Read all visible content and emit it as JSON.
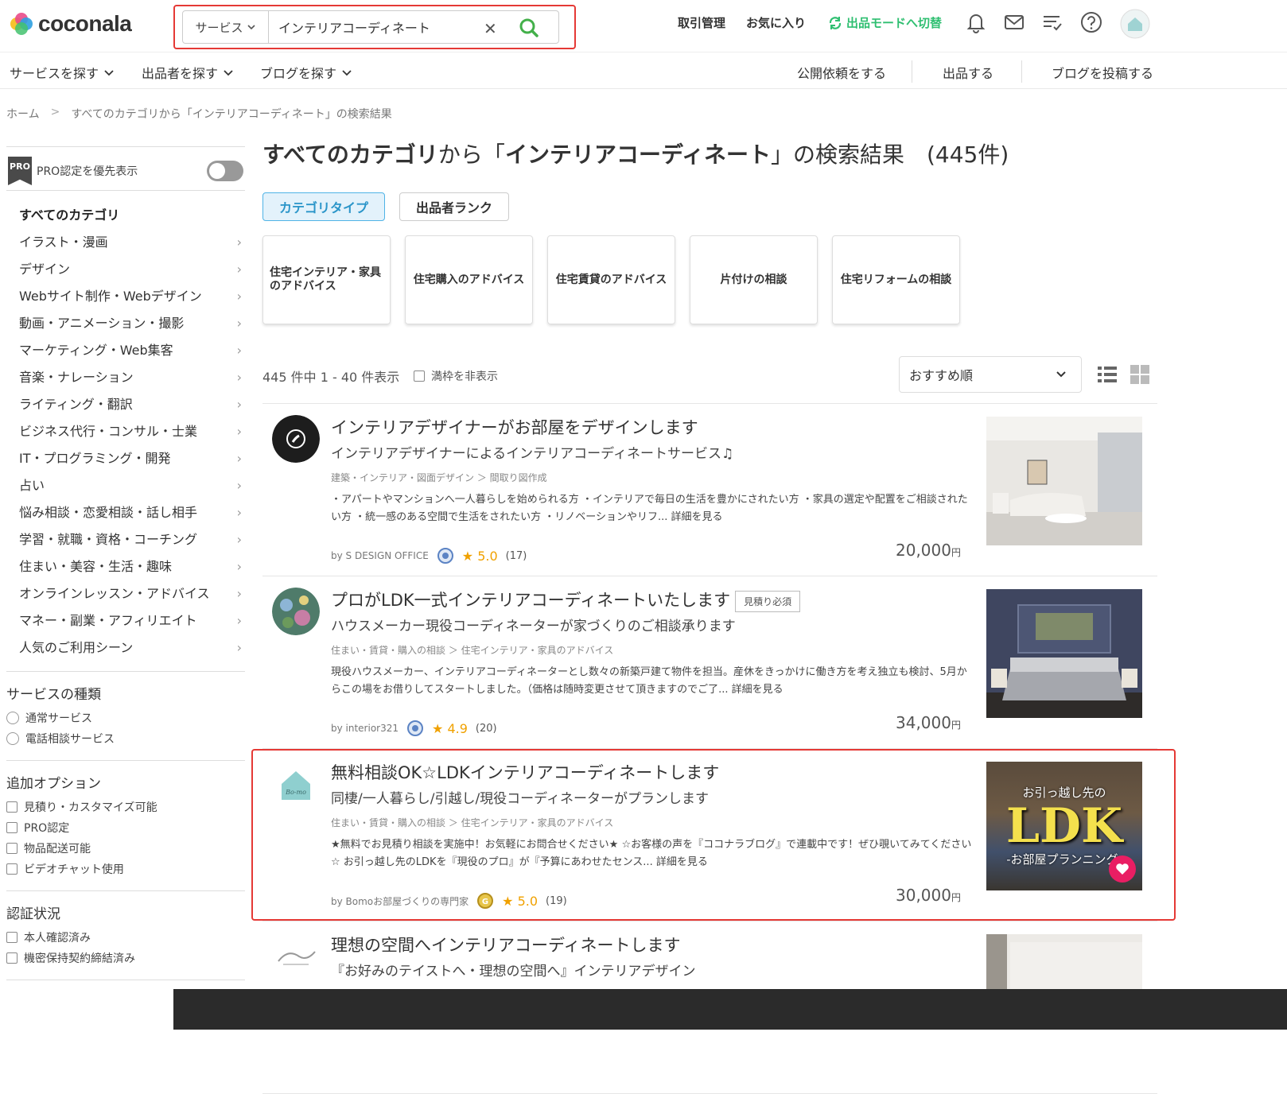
{
  "brand": {
    "name": "coconala"
  },
  "search": {
    "category": "サービス",
    "query": "インテリアコーディネート"
  },
  "header_nav": {
    "deals": "取引管理",
    "favorites": "お気に入り",
    "seller_mode": "出品モードへ切替"
  },
  "subnav": {
    "find_services": "サービスを探す",
    "find_sellers": "出品者を探す",
    "find_blogs": "ブログを探す",
    "public_request": "公開依頼をする",
    "list_service": "出品する",
    "post_blog": "ブログを投稿する"
  },
  "breadcrumb": {
    "home": "ホーム",
    "sep": ">",
    "current": "すべてのカテゴリから「インテリアコーディネート」の検索結果"
  },
  "sidebar": {
    "pro_label": "PRO認定を優先表示",
    "pro_badge": "PRO",
    "categories_heading": "すべてのカテゴリ",
    "categories": [
      "イラスト・漫画",
      "デザイン",
      "Webサイト制作・Webデザイン",
      "動画・アニメーション・撮影",
      "マーケティング・Web集客",
      "音楽・ナレーション",
      "ライティング・翻訳",
      "ビジネス代行・コンサル・士業",
      "IT・プログラミング・開発",
      "占い",
      "悩み相談・恋愛相談・話し相手",
      "学習・就職・資格・コーチング",
      "住まい・美容・生活・趣味",
      "オンラインレッスン・アドバイス",
      "マネー・副業・アフィリエイト",
      "人気のご利用シーン"
    ],
    "service_type": {
      "title": "サービスの種類",
      "options": [
        "通常サービス",
        "電話相談サービス"
      ]
    },
    "options": {
      "title": "追加オプション",
      "options": [
        "見積り・カスタマイズ可能",
        "PRO認定",
        "物品配送可能",
        "ビデオチャット使用"
      ]
    },
    "verification": {
      "title": "認証状況",
      "options": [
        "本人確認済み",
        "機密保持契約締結済み"
      ]
    }
  },
  "main": {
    "title_cat": "すべてのカテゴリ",
    "title_from": "から「",
    "title_query": "インテリアコーディネート",
    "title_suffix": "」の検索結果　(445件)",
    "tabs": [
      "カテゴリタイプ",
      "出品者ランク"
    ],
    "tiles": [
      "住宅インテリア・家具のアドバイス",
      "住宅購入のアドバイス",
      "住宅賃貸のアドバイス",
      "片付けの相談",
      "住宅リフォームの相談"
    ],
    "result_count": "445 件中 1 - 40 件表示",
    "hide_full": "満枠を非表示",
    "sort": "おすすめ順"
  },
  "results": [
    {
      "title": "インテリアデザイナーがお部屋をデザインします",
      "subtitle": "インテリアデザイナーによるインテリアコーディネートサービス♫",
      "crumb": "建築・インテリア・図面デザイン ＞ 間取り図作成",
      "desc": "・アパートやマンションへ一人暮らしを始められる方 ・インテリアで毎日の生活を豊かにされたい方 ・家具の選定や配置をご相談されたい方 ・統一感のある空間で生活をされたい方 ・リノベーションやリフ... 詳細を見る",
      "seller": "by  S DESIGN OFFICE",
      "rating": "★ 5.0",
      "reviews": "(17)",
      "price": "20,000",
      "yen": "円",
      "badge": ""
    },
    {
      "title": "プロがLDK一式インテリアコーディネートいたします",
      "subtitle": "ハウスメーカー現役コーディネーターが家づくりのご相談承ります",
      "crumb": "住まい・賃貸・購入の相談 ＞ 住宅インテリア・家具のアドバイス",
      "desc": "現役ハウスメーカー、インテリアコーディネーターとし数々の新築戸建て物件を担当。産休をきっかけに働き方を考え独立も検討、5月からこの場をお借りしてスタートしました。（価格は随時変更させて頂きますのでご了... 詳細を見る",
      "seller": "by  interior321",
      "rating": "★ 4.9",
      "reviews": "(20)",
      "price": "34,000",
      "yen": "円",
      "badge": "見積り必須"
    },
    {
      "title": "無料相談OK☆LDKインテリアコーディネートします",
      "subtitle": "同棲/一人暮らし/引越し/現役コーディネーターがプランします",
      "crumb": "住まい・賃貸・購入の相談 ＞ 住宅インテリア・家具のアドバイス",
      "desc": "★無料でお見積り相談を実施中！お気軽にお問合せください★ ☆お客様の声を『ココナラブログ』で連載中です！ぜひ覗いてみてください☆ お引っ越し先のLDKを『現役のプロ』が『予算にあわせたセンス... 詳細を見る",
      "seller": "by  Bomoお部屋づくりの専門家",
      "rating": "★ 5.0",
      "reviews": "(19)",
      "price": "30,000",
      "yen": "円",
      "badge": "",
      "thumb_text_top": "お引っ越し先の",
      "thumb_text_main": "LDK",
      "thumb_text_bottom": "-お部屋プランニング-"
    },
    {
      "title": "理想の空間へインテリアコーディネートします",
      "subtitle": "『お好みのテイストへ・理想の空間へ』インテリアデザイン",
      "crumb": "",
      "desc": "",
      "seller": "",
      "rating": "",
      "reviews": "",
      "price": "",
      "yen": "",
      "badge": ""
    }
  ],
  "colors": {
    "accent_green": "#2fbf71",
    "highlight_red": "#e53935",
    "tab_blue": "#4fb3e6",
    "star": "#f0a100",
    "fav_pink": "#e91e63"
  }
}
